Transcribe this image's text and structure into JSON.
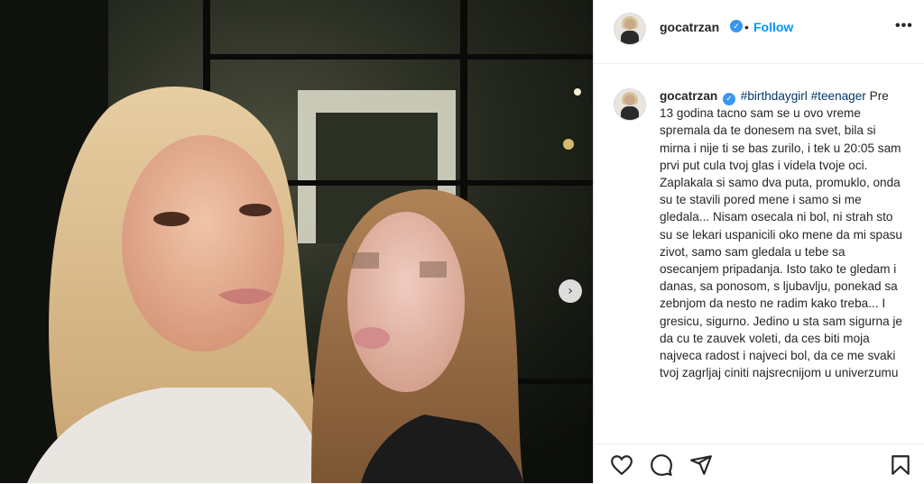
{
  "post": {
    "username": "gocatrzan",
    "separator": "•",
    "follow_label": "Follow",
    "more_label": "•••",
    "next_label": "›",
    "caption": {
      "username": "gocatrzan",
      "tags": "#birthdaygirl #teenager",
      "body": "Pre 13 godina tacno sam se u ovo vreme spremala da te donesem na svet, bila si mirna i nije ti se bas zurilo, i tek u 20:05 sam prvi put cula tvoj glas i videla tvoje oci. Zaplakala si samo dva puta, promuklo, onda su te stavili pored mene i samo si me gledala... Nisam osecala ni bol, ni strah sto su se lekari uspanicili oko mene da mi spasu zivot, samo sam gledala u tebe sa osecanjem pripadanja. Isto tako te gledam i danas, sa ponosom, s ljubavlju, ponekad sa zebnjom da nesto ne radim kako treba... I gresicu, sigurno. Jedino u sta sam sigurna je da cu te zauvek voleti, da ces biti moja najveca radost i najveci bol, da ce me svaki tvoj zagrljaj ciniti najsrecnijom u univerzumu"
    },
    "icons": [
      "heart-icon",
      "comment-icon",
      "share-icon",
      "bookmark-icon"
    ]
  },
  "colors": {
    "accent": "#0095f6",
    "verified": "#3897f0",
    "text": "#262626",
    "hashtag": "#00376b"
  }
}
